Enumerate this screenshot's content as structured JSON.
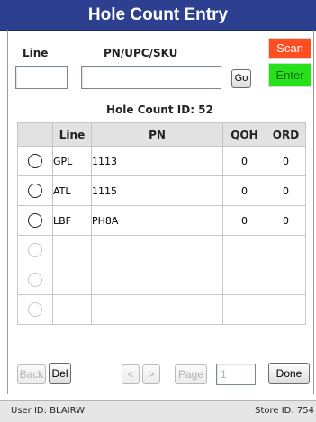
{
  "window": {
    "title": "Hole Count Entry"
  },
  "form": {
    "line_label": "Line",
    "pn_label": "PN/UPC/SKU",
    "line_value": "",
    "pn_value": "",
    "go_label": "Go",
    "scan_label": "Scan",
    "enter_label": "Enter"
  },
  "hole_count": {
    "label": "Hole Count ID: 52"
  },
  "table": {
    "headers": [
      "",
      "Line",
      "PN",
      "QOH",
      "ORD"
    ],
    "rows": [
      {
        "line": "GPL",
        "pn": "1113",
        "qoh": "0",
        "ord": "0"
      },
      {
        "line": "ATL",
        "pn": "1115",
        "qoh": "0",
        "ord": "0"
      },
      {
        "line": "LBF",
        "pn": "PH8A",
        "qoh": "0",
        "ord": "0"
      },
      {
        "line": "",
        "pn": "",
        "qoh": "",
        "ord": ""
      },
      {
        "line": "",
        "pn": "",
        "qoh": "",
        "ord": ""
      },
      {
        "line": "",
        "pn": "",
        "qoh": "",
        "ord": ""
      }
    ]
  },
  "pager": {
    "back_label": "Back",
    "del_label": "Del",
    "prev_label": "<",
    "next_label": ">",
    "page_label": "Page",
    "page_value": "1",
    "done_label": "Done"
  },
  "status": {
    "user": "User ID: BLAIRW",
    "store": "Store ID: 754"
  }
}
